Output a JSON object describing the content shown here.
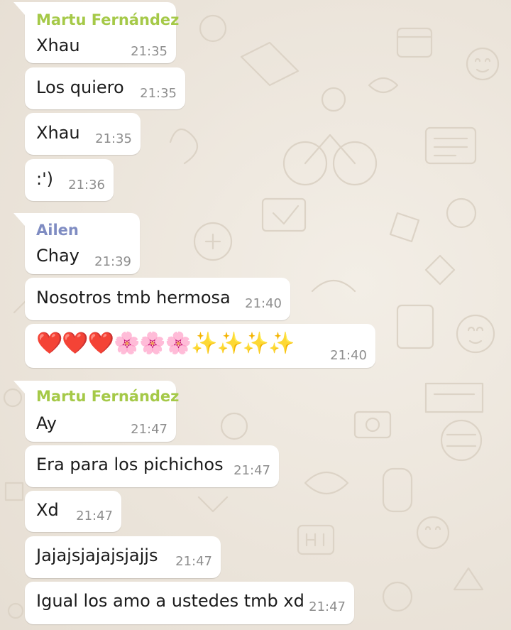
{
  "messages": [
    {
      "sender": "Martu Fernández",
      "text": "Xhau",
      "time": "21:35"
    },
    {
      "text": "Los quiero",
      "time": "21:35"
    },
    {
      "text": "Xhau",
      "time": "21:35"
    },
    {
      "text": ":')",
      "time": "21:36"
    },
    {
      "sender": "Ailen",
      "text": "Chay",
      "time": "21:39"
    },
    {
      "text": "Nosotros tmb hermosa",
      "time": "21:40"
    },
    {
      "text": "❤️❤️❤️🌸🌸🌸✨✨✨✨",
      "time": "21:40"
    },
    {
      "sender": "Martu Fernández",
      "text": "Ay",
      "time": "21:47"
    },
    {
      "text": "Era para los pichichos",
      "time": "21:47"
    },
    {
      "text": "Xd",
      "time": "21:47"
    },
    {
      "text": "Jajajsjajajsjajjs",
      "time": "21:47"
    },
    {
      "text": "Igual los amo a ustedes tmb xd",
      "time": "21:47"
    }
  ],
  "colors": {
    "sender_martu": "#a5c948",
    "sender_ailen": "#7f8cc2",
    "bubble": "#ffffff",
    "wallpaper": "#ece5dd",
    "time": "#8e8e8e"
  }
}
